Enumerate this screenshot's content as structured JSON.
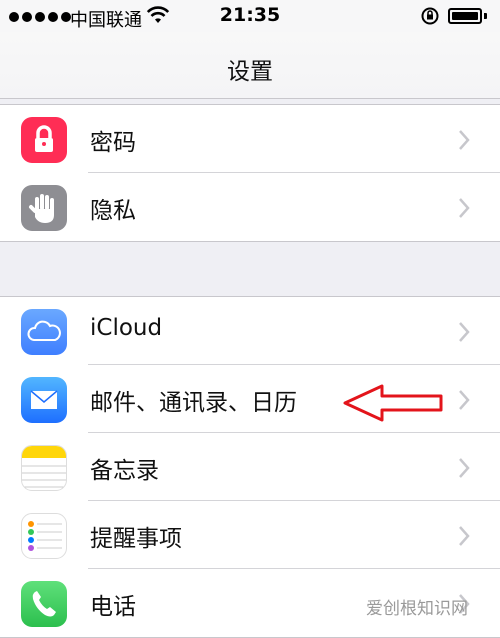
{
  "status_bar": {
    "carrier": "中国联通",
    "time": "21:35"
  },
  "nav": {
    "title": "设置"
  },
  "groups": [
    {
      "rows": [
        {
          "label": "密码",
          "icon": "lock-icon",
          "color": "#ff2d55"
        },
        {
          "label": "隐私",
          "icon": "hand-icon",
          "color": "#8e8e93"
        }
      ]
    },
    {
      "rows": [
        {
          "label": "iCloud",
          "icon": "cloud-icon",
          "color": "#3f7fff"
        },
        {
          "label": "邮件、通讯录、日历",
          "icon": "mail-icon",
          "color": "#1e90ff"
        },
        {
          "label": "备忘录",
          "icon": "notes-icon",
          "color": "#ffd60a"
        },
        {
          "label": "提醒事项",
          "icon": "reminders-icon",
          "color": "#ffffff"
        },
        {
          "label": "电话",
          "icon": "phone-icon",
          "color": "#34c759"
        }
      ]
    }
  ],
  "annotation": {
    "arrow_color": "#e3141b",
    "points_to": "邮件、通讯录、日历"
  },
  "watermark": "爱创根知识网"
}
